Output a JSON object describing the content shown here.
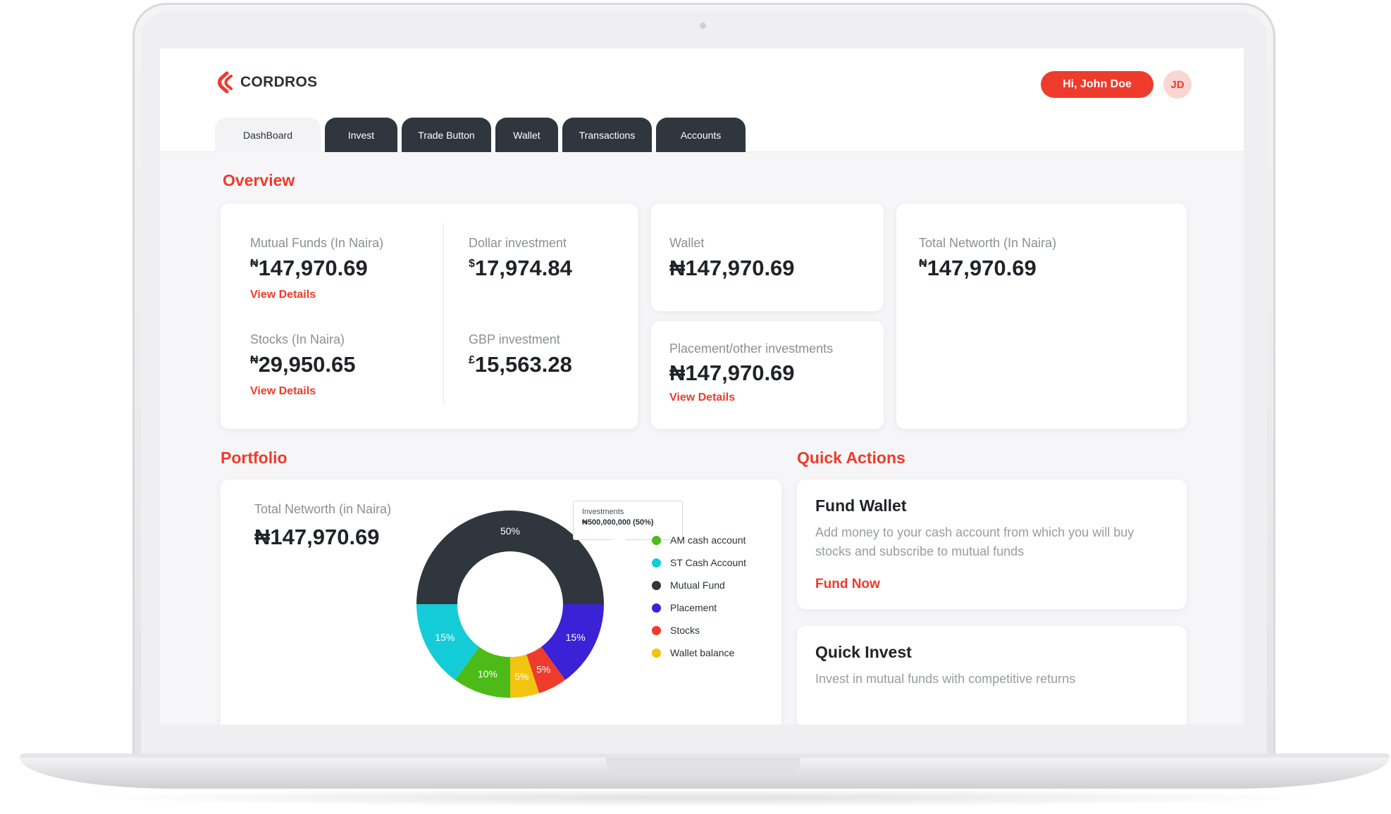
{
  "brand": {
    "name": "CORDROS",
    "accent": "#ee3b2b",
    "dark": "#2f363d"
  },
  "header": {
    "greeting": "Hi, John Doe",
    "avatar_initials": "JD"
  },
  "tabs": [
    {
      "label": "DashBoard",
      "active": true
    },
    {
      "label": "Invest",
      "active": false
    },
    {
      "label": "Trade Button",
      "active": false
    },
    {
      "label": "Wallet",
      "active": false
    },
    {
      "label": "Transactions",
      "active": false
    },
    {
      "label": "Accounts",
      "active": false
    }
  ],
  "overview": {
    "title": "Overview",
    "mutual_funds": {
      "label": "Mutual Funds (In Naira)",
      "currency": "₦",
      "value": "147,970.69",
      "link": "View Details"
    },
    "dollar": {
      "label": "Dollar investment",
      "currency": "$",
      "value": "17,974.84"
    },
    "stocks": {
      "label": "Stocks (In Naira)",
      "currency": "₦",
      "value": "29,950.65",
      "link": "View Details"
    },
    "gbp": {
      "label": "GBP investment",
      "currency": "£",
      "value": "15,563.28"
    },
    "wallet": {
      "label": "Wallet",
      "value": "₦147,970.69"
    },
    "placement": {
      "label": "Placement/other investments",
      "value": "₦147,970.69",
      "link": "View Details"
    },
    "total": {
      "label": "Total Networth (In Naira)",
      "currency": "₦",
      "value": "147,970.69"
    }
  },
  "portfolio": {
    "title": "Portfolio",
    "total_label": "Total Networth (in Naira)",
    "total_value": "₦147,970.69",
    "tooltip": {
      "title": "Investments",
      "value": "₦500,000,000 (50%)"
    }
  },
  "chart_data": {
    "type": "pie",
    "donut": true,
    "categories": [
      "Mutual Fund",
      "Placement",
      "Stocks",
      "Wallet balance",
      "AM cash account",
      "ST Cash Account"
    ],
    "values": [
      50,
      15,
      5,
      5,
      10,
      15
    ],
    "labels": [
      "50%",
      "15%",
      "5%",
      "5%",
      "10%",
      "15%"
    ],
    "colors": [
      "#2f363d",
      "#3b22d6",
      "#ee3b2b",
      "#f1c40f",
      "#4cbb17",
      "#14ccd8"
    ],
    "legend": [
      {
        "name": "AM cash account",
        "color": "#4cbb17"
      },
      {
        "name": "ST Cash Account",
        "color": "#14ccd8"
      },
      {
        "name": "Mutual Fund",
        "color": "#2f363d"
      },
      {
        "name": "Placement",
        "color": "#3b22d6"
      },
      {
        "name": "Stocks",
        "color": "#ee3b2b"
      },
      {
        "name": "Wallet balance",
        "color": "#f1c40f"
      }
    ],
    "legend_position": "right"
  },
  "quick_actions": {
    "title": "Quick Actions",
    "fund_wallet": {
      "title": "Fund Wallet",
      "desc": "Add money to your cash account from which you will buy stocks and subscribe to mutual funds",
      "link": "Fund Now"
    },
    "quick_invest": {
      "title": "Quick Invest",
      "desc": "Invest in mutual funds with competitive returns"
    }
  },
  "icons": {
    "logo": "cordros-logo-icon"
  }
}
